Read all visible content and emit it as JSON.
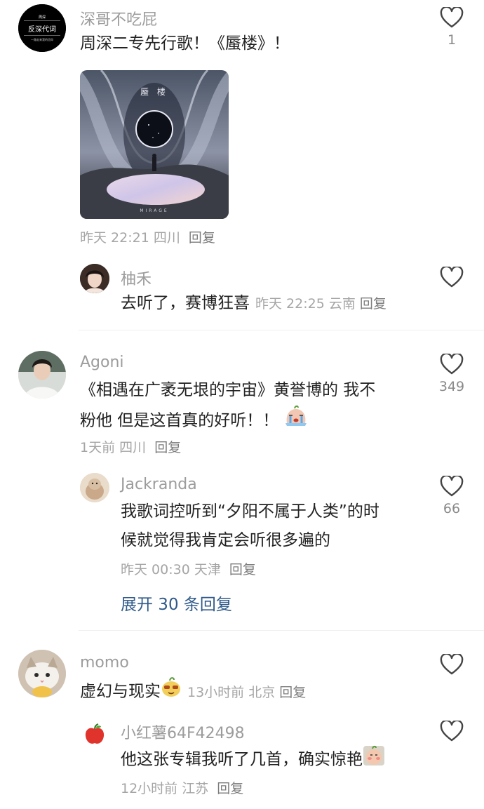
{
  "comments": [
    {
      "user": "深哥不吃屁",
      "avatar_icon": "band-logo-avatar",
      "text": "周深二专先行歌！《蜃楼》！",
      "likes": "1",
      "album": {
        "title": "蜃 楼",
        "subtitle": "MIRAGE"
      },
      "meta": {
        "time": "昨天 22:21",
        "location": "四川",
        "reply": "回复"
      },
      "replies": [
        {
          "user": "柚禾",
          "avatar_icon": "girl-avatar",
          "text": "去听了，赛博狂喜",
          "meta": {
            "time": "昨天 22:25",
            "location": "云南",
            "reply": "回复"
          },
          "likes": ""
        }
      ]
    },
    {
      "user": "Agoni",
      "avatar_icon": "person-avatar",
      "text_line1": "《相遇在广袤无垠的宇宙》黄誉博的 我不",
      "text_line2": "粉他 但是这首真的好听！！",
      "likes": "349",
      "meta": {
        "time": "1天前",
        "location": "四川",
        "reply": "回复"
      },
      "replies": [
        {
          "user": "Jackranda",
          "avatar_icon": "pet-avatar",
          "text_line1": "我歌词控听到“夕阳不属于人类”的时",
          "text_line2": "候就觉得我肯定会听很多遍的",
          "likes": "66",
          "meta": {
            "time": "昨天 00:30",
            "location": "天津",
            "reply": "回复"
          }
        }
      ],
      "expand": "展开 30 条回复"
    },
    {
      "user": "momo",
      "avatar_icon": "cat-avatar",
      "text": "虚幻与现实",
      "meta": {
        "time": "13小时前",
        "location": "北京",
        "reply": "回复"
      },
      "likes": "",
      "replies": [
        {
          "user": "小红薯64F42498",
          "avatar_icon": "apple-avatar",
          "text": "他这张专辑我听了几首，确实惊艳",
          "likes": "",
          "meta": {
            "time": "12小时前",
            "location": "江苏",
            "reply": "回复"
          }
        }
      ]
    }
  ],
  "icons": {
    "like": "heart-outline-icon"
  },
  "colors": {
    "link": "#2f5a8a",
    "meta": "#a5a5a5",
    "name": "#9c9c9c"
  }
}
